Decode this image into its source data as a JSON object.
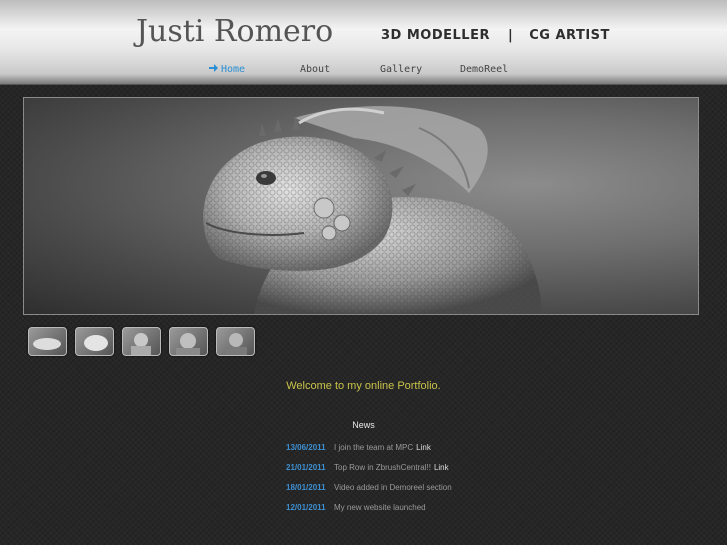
{
  "header": {
    "title": "Justi Romero",
    "tagline_left": "3D MODELLER",
    "tagline_sep": "|",
    "tagline_right": "CG ARTIST"
  },
  "nav": {
    "items": [
      {
        "label": "Home",
        "active": true,
        "icon": "arrow-right-icon"
      },
      {
        "label": "About"
      },
      {
        "label": "Gallery"
      },
      {
        "label": "DemoReel"
      }
    ],
    "active_color": "#2a8fd4"
  },
  "gallery": {
    "thumb_count": 5
  },
  "welcome": "Welcome to my online Portfolio.",
  "news": {
    "heading": "News",
    "items": [
      {
        "date": "13/06/2011",
        "text": "I join the team at MPC",
        "link": "Link"
      },
      {
        "date": "21/01/2011",
        "text": "Top Row in ZbrushCentral!!",
        "link": "Link"
      },
      {
        "date": "18/01/2011",
        "text": "Video added in Demoreel section",
        "link": ""
      },
      {
        "date": "12/01/2011",
        "text": "My new website launched",
        "link": ""
      }
    ]
  }
}
